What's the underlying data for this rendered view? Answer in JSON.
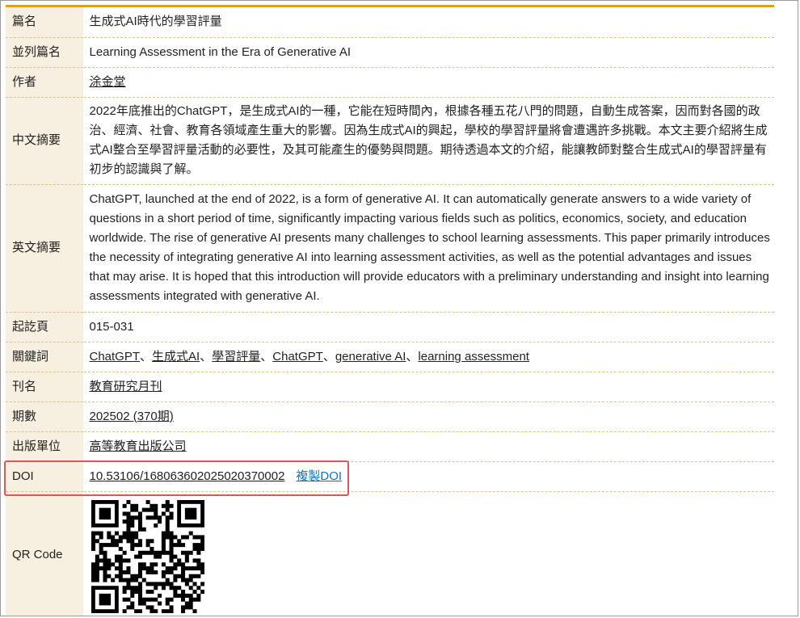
{
  "rows": {
    "title": {
      "label": "篇名",
      "value": "生成式AI時代的學習評量"
    },
    "parallel_title": {
      "label": "並列篇名",
      "value": "Learning Assessment in the Era of Generative AI"
    },
    "author": {
      "label": "作者",
      "value": "涂金堂"
    },
    "abstract_zh": {
      "label": "中文摘要",
      "value": "2022年底推出的ChatGPT，是生成式AI的一種，它能在短時間內，根據各種五花八門的問題，自動生成答案，因而對各國的政治、經濟、社會、教育各領域產生重大的影響。因為生成式AI的興起，學校的學習評量將會遭遇許多挑戰。本文主要介紹將生成式AI整合至學習評量活動的必要性，及其可能產生的優勢與問題。期待透過本文的介紹，能讓教師對整合生成式AI的學習評量有初步的認識與了解。"
    },
    "abstract_en": {
      "label": "英文摘要",
      "value": "ChatGPT, launched at the end of 2022, is a form of generative AI. It can automatically generate answers to a wide variety of questions in a short period of time, significantly impacting various fields such as politics, economics, society, and education worldwide. The rise of generative AI presents many challenges to school learning assessments. This paper primarily introduces the necessity of integrating generative AI into learning assessment activities, as well as the potential advantages and issues that may arise. It is hoped that this introduction will provide educators with a preliminary understanding and insight into learning assessments integrated with generative AI."
    },
    "pages": {
      "label": "起訖頁",
      "value": "015-031"
    },
    "keywords": {
      "label": "關鍵詞",
      "items": [
        "ChatGPT",
        "生成式AI",
        "學習評量",
        "ChatGPT",
        "generative AI",
        "learning assessment"
      ],
      "separator": "、"
    },
    "journal": {
      "label": "刊名",
      "value": "教育研究月刊"
    },
    "issue": {
      "label": "期數",
      "value": "202502 (370期)"
    },
    "publisher": {
      "label": "出版單位",
      "value": "高等教育出版公司"
    },
    "doi": {
      "label": "DOI",
      "value": "10.53106/168063602025020370002",
      "copy_label": "複製DOI"
    },
    "qr": {
      "label": "QR Code"
    }
  },
  "colors": {
    "accent_bar": "#d9a21f",
    "label_bg": "#f7f0e1",
    "copy_link": "#1a73b8",
    "highlight": "#e05555"
  }
}
